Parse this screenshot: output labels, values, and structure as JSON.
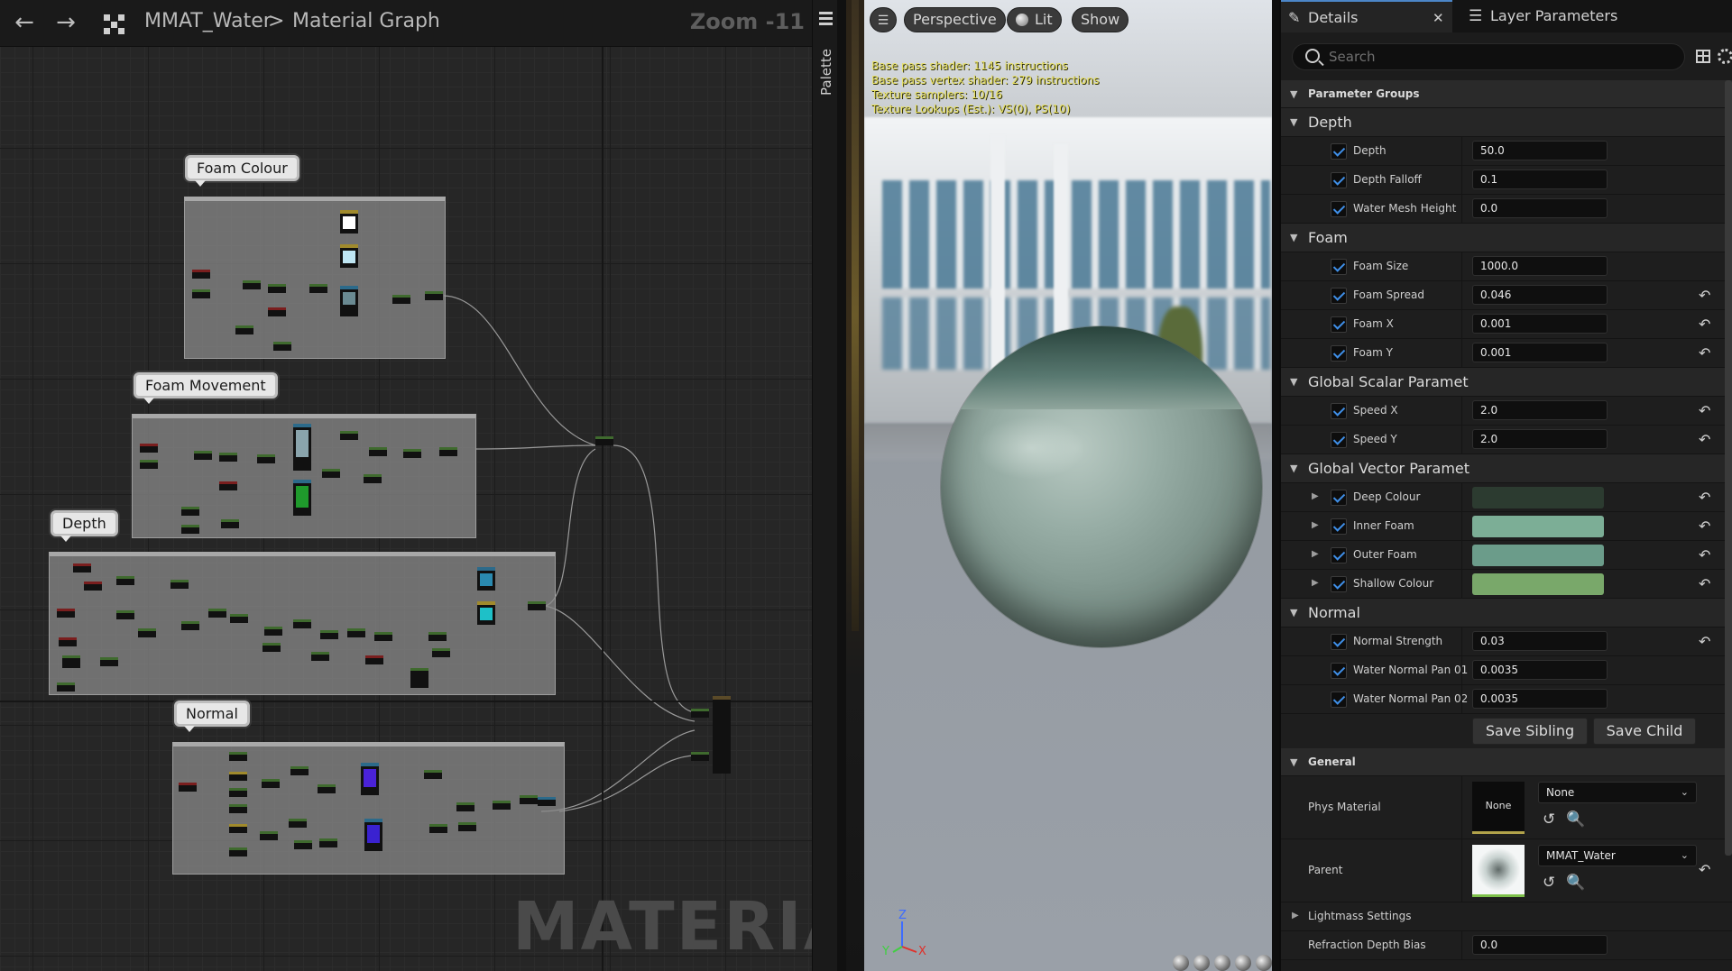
{
  "graph": {
    "breadcrumb": {
      "asset": "MMAT_Water",
      "separator": ">",
      "graph": "Material Graph"
    },
    "zoom": "Zoom -11",
    "palette_label": "Palette",
    "watermark": "MATERIAL",
    "comments": [
      {
        "label": "Foam Colour"
      },
      {
        "label": "Foam Movement"
      },
      {
        "label": "Depth"
      },
      {
        "label": "Normal"
      }
    ]
  },
  "viewport": {
    "buttons": {
      "menu_icon": "hamburger-icon",
      "perspective": "Perspective",
      "lit": "Lit",
      "show": "Show"
    },
    "stats": [
      "Base pass shader: 1145 instructions",
      "Base pass vertex shader: 279 instructions",
      "Texture samplers: 10/16",
      "Texture Lookups (Est.): VS(0), PS(10)"
    ],
    "gizmo": {
      "z": "Z",
      "y": "Y",
      "x": "X"
    }
  },
  "details": {
    "tabs": {
      "details": "Details",
      "layer_parameters": "Layer Parameters"
    },
    "search_placeholder": "Search",
    "parameter_groups_label": "Parameter Groups",
    "groups": [
      {
        "name": "Depth",
        "params": [
          {
            "label": "Depth",
            "value": "50.0",
            "reset": false
          },
          {
            "label": "Depth Falloff",
            "value": "0.1",
            "reset": false
          },
          {
            "label": "Water Mesh Height",
            "value": "0.0",
            "reset": false
          }
        ]
      },
      {
        "name": "Foam",
        "params": [
          {
            "label": "Foam Size",
            "value": "1000.0",
            "reset": false
          },
          {
            "label": "Foam Spread",
            "value": "0.046",
            "reset": true
          },
          {
            "label": "Foam X",
            "value": "0.001",
            "reset": true
          },
          {
            "label": "Foam Y",
            "value": "0.001",
            "reset": true
          }
        ]
      },
      {
        "name": "Global Scalar Paramet",
        "params": [
          {
            "label": "Speed X",
            "value": "2.0",
            "reset": true
          },
          {
            "label": "Speed Y",
            "value": "2.0",
            "reset": true
          }
        ]
      },
      {
        "name": "Global Vector Paramet",
        "params": [
          {
            "label": "Deep Colour",
            "color": "#2c3b30",
            "reset": true
          },
          {
            "label": "Inner Foam",
            "color": "#7cae96",
            "reset": true
          },
          {
            "label": "Outer Foam",
            "color": "#6b9c8a",
            "reset": true
          },
          {
            "label": "Shallow Colour",
            "color": "#79a86a",
            "reset": true
          }
        ]
      },
      {
        "name": "Normal",
        "params": [
          {
            "label": "Normal Strength",
            "value": "0.03",
            "reset": true
          },
          {
            "label": "Water Normal Pan 01",
            "value": "0.0035",
            "reset": false
          },
          {
            "label": "Water Normal Pan 02",
            "value": "0.0035",
            "reset": false
          }
        ]
      }
    ],
    "save_sibling": "Save Sibling",
    "save_child": "Save Child",
    "general_label": "General",
    "phys_material": {
      "label": "Phys Material",
      "thumb_text": "None",
      "combo": "None"
    },
    "parent": {
      "label": "Parent",
      "combo": "MMAT_Water"
    },
    "lightmass_label": "Lightmass Settings",
    "refraction": {
      "label": "Refraction Depth Bias",
      "value": "0.0"
    }
  }
}
